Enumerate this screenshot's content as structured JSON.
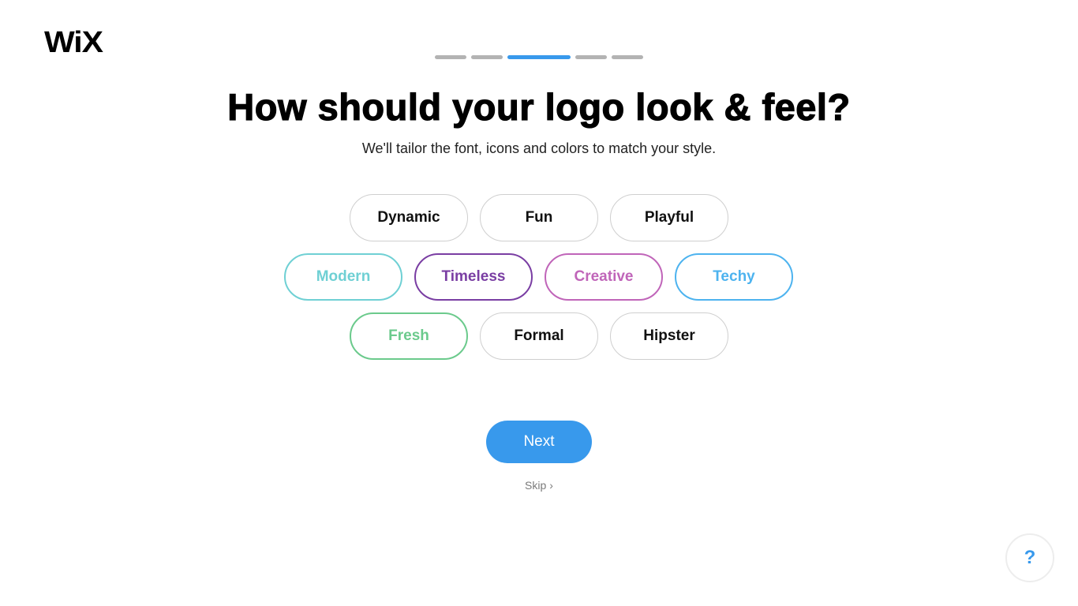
{
  "brand": {
    "logo_text": "WiX"
  },
  "progress": {
    "total_steps": 5,
    "current_step": 3
  },
  "header": {
    "title": "How should your logo look & feel?",
    "subtitle": "We'll tailor the font, icons and colors to match your style."
  },
  "styles": [
    {
      "label": "Dynamic",
      "selected": false,
      "color": "#111111"
    },
    {
      "label": "Fun",
      "selected": false,
      "color": "#111111"
    },
    {
      "label": "Playful",
      "selected": false,
      "color": "#111111"
    },
    {
      "label": "Modern",
      "selected": true,
      "color": "#6fd0d4"
    },
    {
      "label": "Timeless",
      "selected": true,
      "color": "#7a3ea3"
    },
    {
      "label": "Creative",
      "selected": true,
      "color": "#c065b9"
    },
    {
      "label": "Techy",
      "selected": true,
      "color": "#4db3ef"
    },
    {
      "label": "Fresh",
      "selected": true,
      "color": "#6bca8c"
    },
    {
      "label": "Formal",
      "selected": false,
      "color": "#111111"
    },
    {
      "label": "Hipster",
      "selected": false,
      "color": "#111111"
    }
  ],
  "actions": {
    "next_label": "Next",
    "skip_label": "Skip"
  },
  "help": {
    "label": "?"
  },
  "colors": {
    "accent": "#3899ec",
    "inactive_step": "#b3b3b3"
  }
}
